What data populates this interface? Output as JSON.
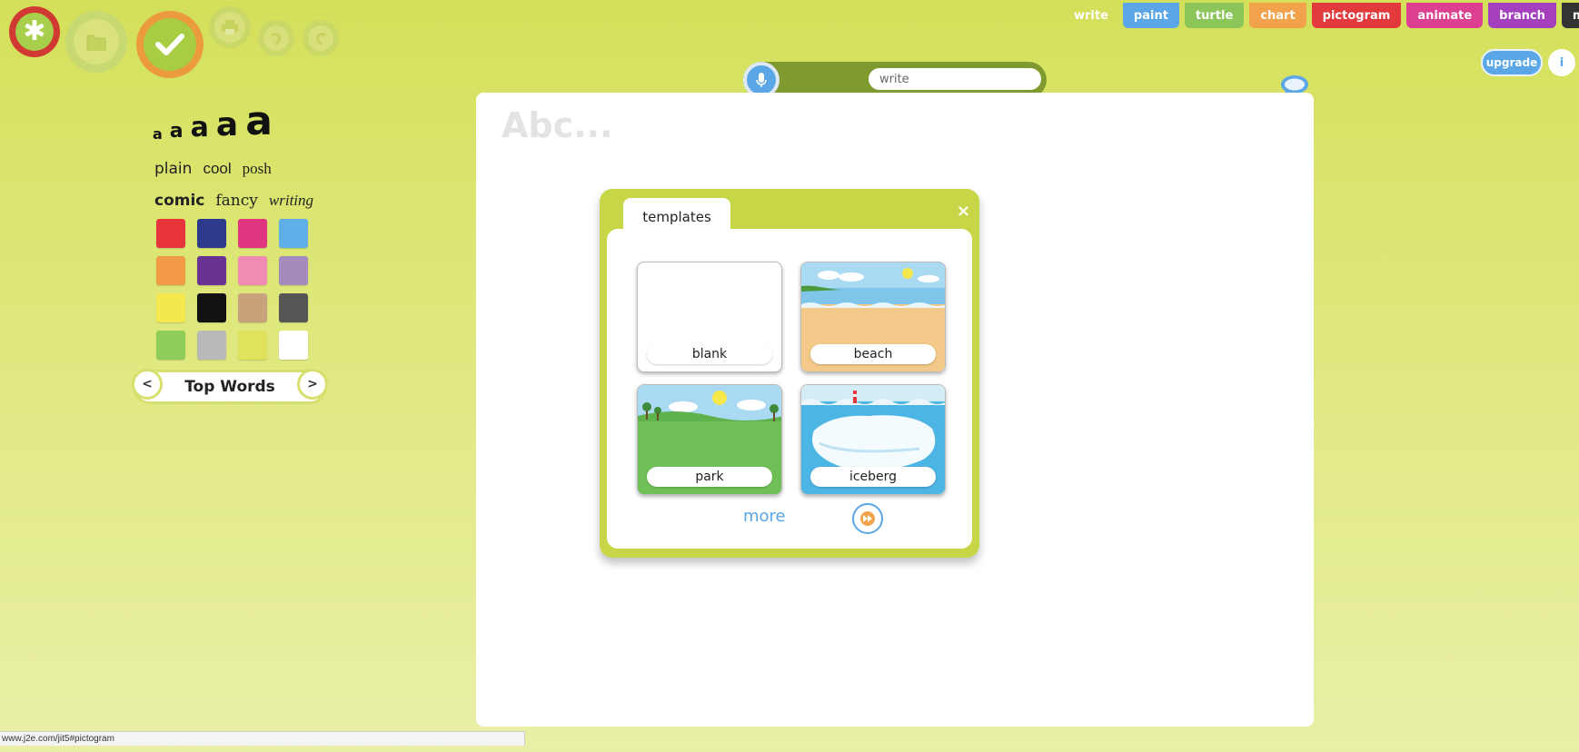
{
  "toolbar": {
    "new_icon": "asterisk-icon",
    "open_icon": "folder-icon",
    "save_icon": "checkmark-icon",
    "print_icon": "printer-icon",
    "undo_icon": "undo-icon",
    "redo_icon": "redo-icon"
  },
  "app_tabs": [
    {
      "label": "write",
      "color": "transparent"
    },
    {
      "label": "paint",
      "color": "#5aa6e6"
    },
    {
      "label": "turtle",
      "color": "#8cc65b"
    },
    {
      "label": "chart",
      "color": "#f2a24a"
    },
    {
      "label": "pictogram",
      "color": "#e2393c"
    },
    {
      "label": "animate",
      "color": "#dc3f8f"
    },
    {
      "label": "branch",
      "color": "#a43fbd"
    },
    {
      "label": "mix",
      "color": "#333333"
    }
  ],
  "header": {
    "upgrade_label": "upgrade",
    "info_label": "i"
  },
  "voice": {
    "mic_icon": "microphone-icon",
    "input_value": "write"
  },
  "font_panel": {
    "size_glyph": "a",
    "styles_row1": [
      "plain",
      "cool",
      "posh"
    ],
    "styles_row2": [
      "comic",
      "fancy",
      "writing"
    ]
  },
  "colors": [
    "#e8343b",
    "#2e3a8c",
    "#e0357f",
    "#5faee8",
    "#f29a45",
    "#6a3293",
    "#f08bb4",
    "#a48bbd",
    "#f5e84e",
    "#111111",
    "#c7a27a",
    "#555555",
    "#8fcd5a",
    "#b9b9b9",
    "#dfe25a",
    "#ffffff"
  ],
  "top_words": {
    "label": "Top Words",
    "prev": "<",
    "next": ">"
  },
  "canvas": {
    "placeholder": "Abc..."
  },
  "templates_dialog": {
    "tab_label": "templates",
    "close_label": "×",
    "items": [
      {
        "label": "blank"
      },
      {
        "label": "beach"
      },
      {
        "label": "park"
      },
      {
        "label": "iceberg"
      }
    ],
    "more_label": "more"
  },
  "status": {
    "url": "www.j2e.com/jit5#pictogram"
  }
}
